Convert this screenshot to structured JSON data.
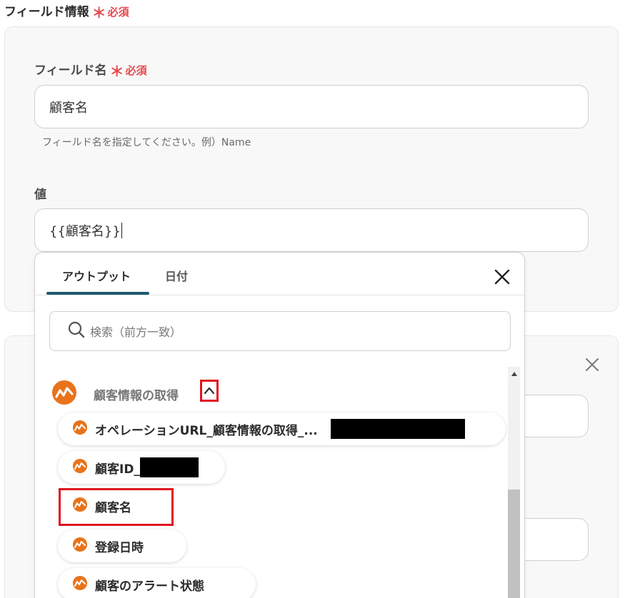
{
  "section": {
    "title": "フィールド情報",
    "required_mark": "＊",
    "required_text": "必須"
  },
  "field_name": {
    "label": "フィールド名",
    "required_mark": "＊",
    "required_text": "必須",
    "value": "顧客名",
    "hint": "フィールド名を指定してください。例）Name"
  },
  "value_field": {
    "label": "値",
    "value": "{{顧客名}}"
  },
  "popup": {
    "tabs": [
      {
        "label": "アウトプット"
      },
      {
        "label": "日付"
      }
    ],
    "search_placeholder": "検索（前方一致）",
    "group": {
      "title": "顧客情報の取得",
      "items": [
        {
          "label": "オペレーションURL_顧客情報の取得_..."
        },
        {
          "label": "顧客ID_"
        },
        {
          "label": "顧客名"
        },
        {
          "label": "登録日時"
        },
        {
          "label": "顧客のアラート状態"
        }
      ]
    }
  },
  "colors": {
    "required": "#e5484d",
    "accent": "#1f5a73",
    "brand_icon": "#e8731a",
    "highlight": "#e0141d"
  }
}
